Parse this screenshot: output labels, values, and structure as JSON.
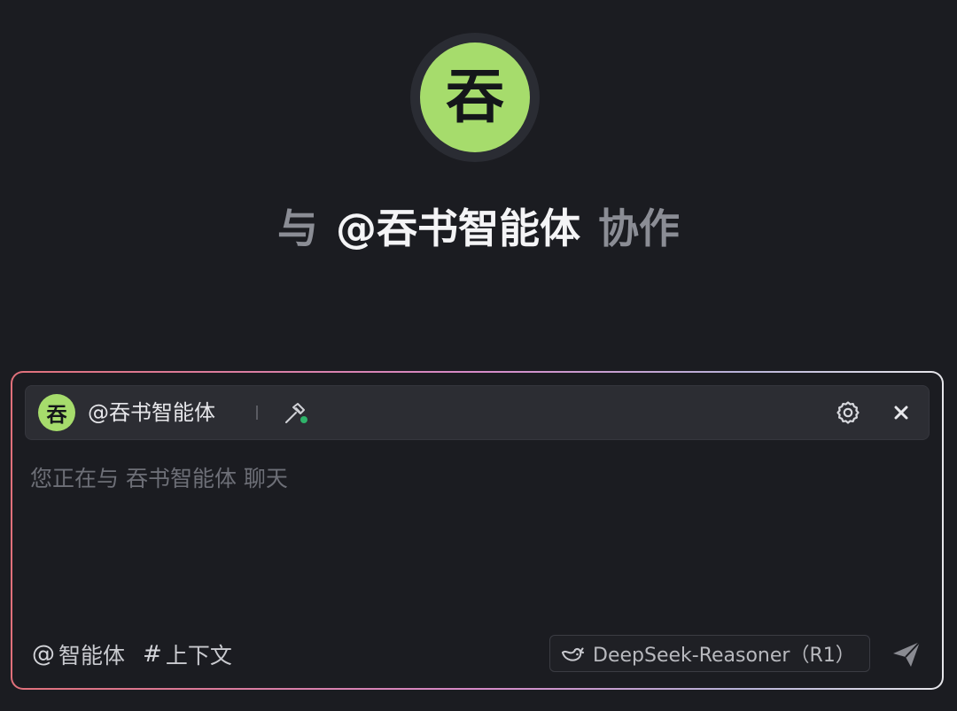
{
  "hero": {
    "avatar_char": "吞",
    "prefix": "与",
    "agent_mention": "@吞书智能体",
    "suffix": "协作"
  },
  "composer": {
    "agent_bar": {
      "avatar_char": "吞",
      "agent_name": "@吞书智能体",
      "tool_icon": "hammer-icon",
      "settings_icon": "gear-icon",
      "close_icon": "close-icon"
    },
    "input": {
      "value": "",
      "placeholder": "您正在与 吞书智能体 聊天"
    },
    "bottom": {
      "mention_symbol": "@",
      "mention_label": "智能体",
      "context_symbol": "#",
      "context_label": "上下文",
      "model_label": "DeepSeek-Reasoner（R1）",
      "model_icon": "deepseek-whale-icon",
      "send_icon": "send-icon"
    }
  },
  "colors": {
    "background": "#1b1c21",
    "avatar_green": "#a6dc6c",
    "border_gradient_start": "#e0707a",
    "border_gradient_end": "#e6e6ea"
  }
}
